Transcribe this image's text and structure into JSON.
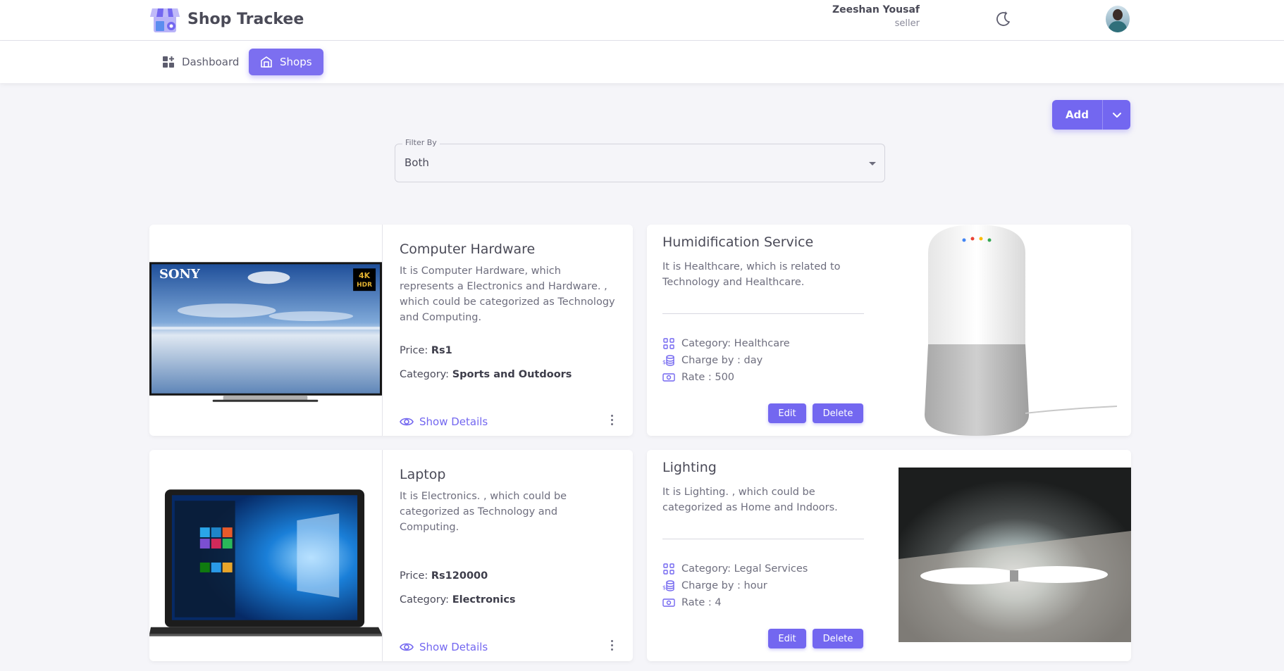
{
  "header": {
    "app_name": "Shop Trackee",
    "user_name": "Zeeshan Yousaf",
    "user_role": "seller",
    "theme_icon": "moon-icon",
    "avatar_icon": "avatar"
  },
  "nav": {
    "items": [
      {
        "label": "Dashboard",
        "icon": "dashboard-icon",
        "active": false
      },
      {
        "label": "Shops",
        "icon": "shop-icon",
        "active": true
      }
    ]
  },
  "toolbar": {
    "add_label": "Add",
    "add_toggle_icon": "chevron-down-icon"
  },
  "filter": {
    "label": "Filter By",
    "value": "Both"
  },
  "colors": {
    "accent": "#7367f0",
    "background": "#f5f5f9",
    "card": "#ffffff"
  },
  "products": [
    {
      "title": "Computer Hardware",
      "description": "It is Computer Hardware, which represents a Electronics and Hardware. , which could be categorized as Technology and Computing.",
      "price_label": "Price:",
      "price_value": "Rs1",
      "category_label": "Category:",
      "category_value": "Sports and Outdoors",
      "details_label": "Show Details",
      "image": "sony-4k-tv-image"
    },
    {
      "title": "Laptop",
      "description": "It is Electronics. , which could be categorized as Technology and Computing.",
      "price_label": "Price:",
      "price_value": "Rs120000",
      "category_label": "Category:",
      "category_value": "Electronics",
      "details_label": "Show Details",
      "image": "laptop-image"
    }
  ],
  "services": [
    {
      "title": "Humidification Service",
      "description": "It is Healthcare, which is related to Technology and Healthcare.",
      "category": "Category: Healthcare",
      "charge_by": "Charge by : day",
      "rate": "Rate : 500",
      "edit_label": "Edit",
      "delete_label": "Delete",
      "image": "smart-speaker-image"
    },
    {
      "title": "Lighting",
      "description": "It is Lighting. , which could be categorized as Home and Indoors.",
      "category": "Category: Legal Services",
      "charge_by": "Charge by : hour",
      "rate": "Rate : 4",
      "edit_label": "Edit",
      "delete_label": "Delete",
      "image": "light-tube-image"
    }
  ]
}
